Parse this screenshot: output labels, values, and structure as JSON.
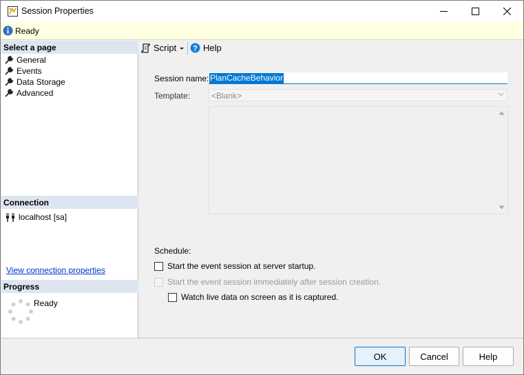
{
  "window": {
    "title": "Session Properties"
  },
  "status": {
    "text": "Ready"
  },
  "left_pane": {
    "select_page_header": "Select a page",
    "pages": [
      {
        "label": "General"
      },
      {
        "label": "Events"
      },
      {
        "label": "Data Storage"
      },
      {
        "label": "Advanced"
      }
    ],
    "connection_header": "Connection",
    "connection_value": "localhost [sa]",
    "view_connection_link": "View connection properties",
    "progress_header": "Progress",
    "progress_text": "Ready"
  },
  "toolbar": {
    "script_label": "Script",
    "help_label": "Help"
  },
  "form": {
    "session_name_label": "Session name:",
    "session_name_value": "PlanCacheBehavior",
    "template_label": "Template:",
    "template_value": "<Blank>",
    "schedule_label": "Schedule:",
    "options": [
      {
        "label": "Start the event session at server startup.",
        "checked": false,
        "enabled": true
      },
      {
        "label": "Start the event session immediately after session creation.",
        "checked": false,
        "enabled": false
      },
      {
        "label": "Watch live data on screen as it is captured.",
        "checked": false,
        "enabled": true
      }
    ]
  },
  "buttons": {
    "ok": "OK",
    "cancel": "Cancel",
    "help": "Help"
  },
  "colors": {
    "accent": "#0078d4",
    "status_bg": "#ffffe1",
    "section_header_bg": "#dde6f0",
    "link": "#0033cc"
  }
}
